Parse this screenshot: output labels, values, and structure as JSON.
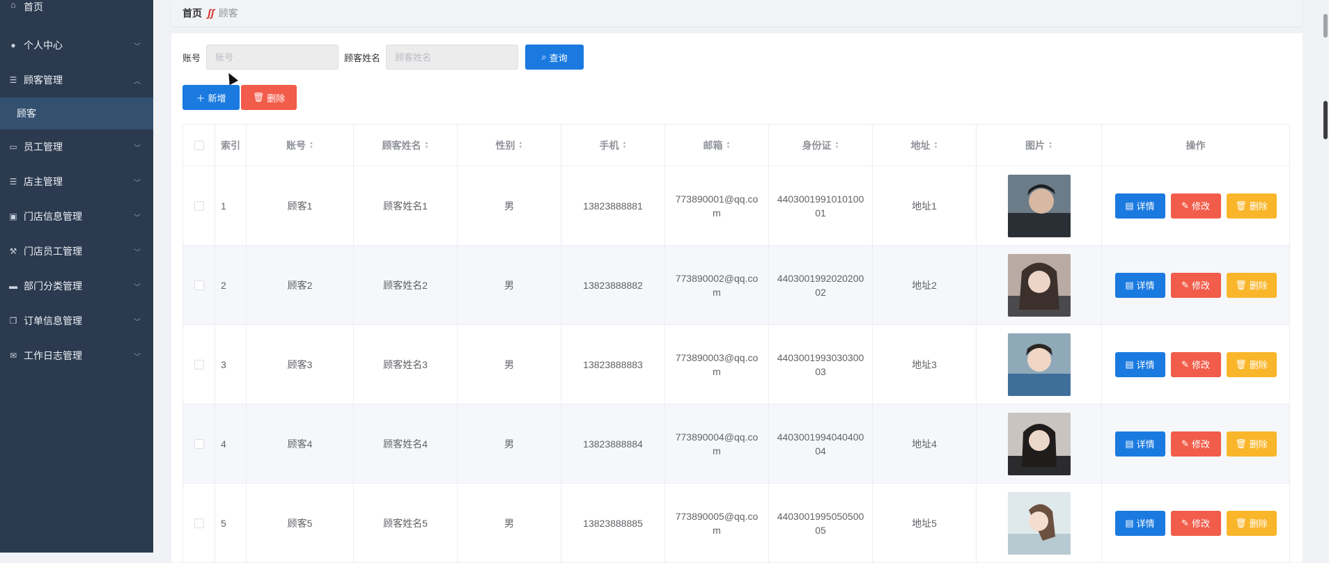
{
  "sidebar": {
    "items": [
      {
        "label": "首页",
        "icon": "home-icon",
        "expandable": false
      },
      {
        "label": "个人中心",
        "icon": "user-icon",
        "expandable": true
      },
      {
        "label": "顾客管理",
        "icon": "list-icon",
        "expandable": true,
        "expanded": true
      },
      {
        "label": "员工管理",
        "icon": "chat-icon",
        "expandable": true
      },
      {
        "label": "店主管理",
        "icon": "list-icon",
        "expandable": true
      },
      {
        "label": "门店信息管理",
        "icon": "briefcase-icon",
        "expandable": true
      },
      {
        "label": "门店员工管理",
        "icon": "tools-icon",
        "expandable": true
      },
      {
        "label": "部门分类管理",
        "icon": "tag-icon",
        "expandable": true
      },
      {
        "label": "订单信息管理",
        "icon": "copy-icon",
        "expandable": true
      },
      {
        "label": "工作日志管理",
        "icon": "mail-icon",
        "expandable": true
      }
    ],
    "active_sub": "顾客"
  },
  "breadcrumb": {
    "home": "首页",
    "current": "顾客"
  },
  "search": {
    "account_label": "账号",
    "account_placeholder": "账号",
    "name_label": "顾客姓名",
    "name_placeholder": "顾客姓名",
    "query_label": "查询"
  },
  "actions": {
    "add_label": "新增",
    "delete_label": "删除"
  },
  "table": {
    "headers": {
      "index": "索引",
      "account": "账号",
      "name": "顾客姓名",
      "sex": "性别",
      "phone": "手机",
      "email": "邮箱",
      "idcard": "身份证",
      "address": "地址",
      "image": "图片",
      "ops": "操作"
    },
    "op_labels": {
      "detail": "详情",
      "edit": "修改",
      "delete": "删除"
    },
    "rows": [
      {
        "index": "1",
        "account": "顾客1",
        "name": "顾客姓名1",
        "sex": "男",
        "phone": "13823888881",
        "email": "773890001@qq.com",
        "idcard": "440300199101010001",
        "address": "地址1"
      },
      {
        "index": "2",
        "account": "顾客2",
        "name": "顾客姓名2",
        "sex": "男",
        "phone": "13823888882",
        "email": "773890002@qq.com",
        "idcard": "440300199202020002",
        "address": "地址2"
      },
      {
        "index": "3",
        "account": "顾客3",
        "name": "顾客姓名3",
        "sex": "男",
        "phone": "13823888883",
        "email": "773890003@qq.com",
        "idcard": "440300199303030003",
        "address": "地址3"
      },
      {
        "index": "4",
        "account": "顾客4",
        "name": "顾客姓名4",
        "sex": "男",
        "phone": "13823888884",
        "email": "773890004@qq.com",
        "idcard": "440300199404040004",
        "address": "地址4"
      },
      {
        "index": "5",
        "account": "顾客5",
        "name": "顾客姓名5",
        "sex": "男",
        "phone": "13823888885",
        "email": "773890005@qq.com",
        "idcard": "440300199505050005",
        "address": "地址5"
      }
    ]
  },
  "colors": {
    "sidebar": "#2b3a4f",
    "primary": "#1a7ae0",
    "danger": "#f25c4a",
    "warning": "#f9b62a"
  }
}
